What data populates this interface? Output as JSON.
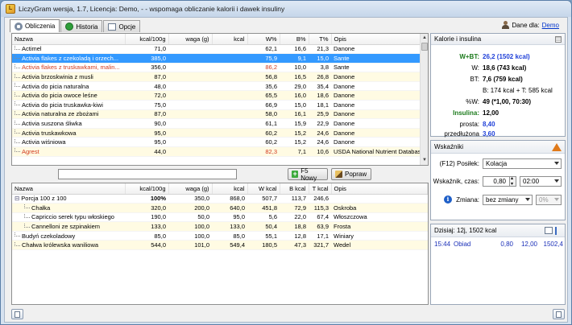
{
  "window": {
    "title": "LiczyGram wersja, 1.7, Licencja: Demo, - - wspomaga obliczanie kalorii i dawek insuliny"
  },
  "tabs": [
    {
      "label": "Obliczenia",
      "active": true,
      "icon": "calculator-icon"
    },
    {
      "label": "Historia",
      "active": false,
      "icon": "history-icon"
    },
    {
      "label": "Opcje",
      "active": false,
      "icon": "options-icon"
    }
  ],
  "user": {
    "label": "Dane dla:",
    "link": "Demo"
  },
  "foods": {
    "columns": [
      "Nazwa",
      "kcal/100g",
      "waga (g)",
      "kcal",
      "W%",
      "B%",
      "T%",
      "Opis"
    ],
    "rows": [
      {
        "name": "Actimel",
        "kcal": "71,0",
        "waga": "",
        "kcal_total": "",
        "w": "62,1",
        "b": "16,6",
        "t": "21,3",
        "opis": "Danone",
        "style": "",
        "w_red": false
      },
      {
        "name": "Activia flakes z czekoladą i orzech...",
        "kcal": "385,0",
        "waga": "",
        "kcal_total": "",
        "w": "75,9",
        "b": "9,1",
        "t": "15,0",
        "opis": "Sante",
        "style": "sel",
        "w_red": false
      },
      {
        "name": "Activia flakes z truskawkami, malin...",
        "kcal": "356,0",
        "waga": "",
        "kcal_total": "",
        "w": "86,2",
        "b": "10,0",
        "t": "3,8",
        "opis": "Sante",
        "style": "red",
        "w_red": true
      },
      {
        "name": "Activia brzoskwinia z musli",
        "kcal": "87,0",
        "waga": "",
        "kcal_total": "",
        "w": "56,8",
        "b": "16,5",
        "t": "26,8",
        "opis": "Danone",
        "style": "",
        "w_red": false
      },
      {
        "name": "Activia do picia naturalna",
        "kcal": "48,0",
        "waga": "",
        "kcal_total": "",
        "w": "35,6",
        "b": "29,0",
        "t": "35,4",
        "opis": "Danone",
        "style": "",
        "w_red": false
      },
      {
        "name": "Activia do picia owoce leśne",
        "kcal": "72,0",
        "waga": "",
        "kcal_total": "",
        "w": "65,5",
        "b": "16,0",
        "t": "18,6",
        "opis": "Danone",
        "style": "",
        "w_red": false
      },
      {
        "name": "Activia do picia truskawka-kiwi",
        "kcal": "75,0",
        "waga": "",
        "kcal_total": "",
        "w": "66,9",
        "b": "15,0",
        "t": "18,1",
        "opis": "Danone",
        "style": "",
        "w_red": false
      },
      {
        "name": "Activia naturalna ze zbożami",
        "kcal": "87,0",
        "waga": "",
        "kcal_total": "",
        "w": "58,0",
        "b": "16,1",
        "t": "25,9",
        "opis": "Danone",
        "style": "",
        "w_red": false
      },
      {
        "name": "Activia suszona śliwka",
        "kcal": "90,0",
        "waga": "",
        "kcal_total": "",
        "w": "61,1",
        "b": "15,9",
        "t": "22,9",
        "opis": "Danone",
        "style": "",
        "w_red": false
      },
      {
        "name": "Activia truskawkowa",
        "kcal": "95,0",
        "waga": "",
        "kcal_total": "",
        "w": "60,2",
        "b": "15,2",
        "t": "24,6",
        "opis": "Danone",
        "style": "",
        "w_red": false
      },
      {
        "name": "Activia wiśniowa",
        "kcal": "95,0",
        "waga": "",
        "kcal_total": "",
        "w": "60,2",
        "b": "15,2",
        "t": "24,6",
        "opis": "Danone",
        "style": "",
        "w_red": false
      },
      {
        "name": "Agrest",
        "kcal": "44,0",
        "waga": "",
        "kcal_total": "",
        "w": "82,3",
        "b": "7,1",
        "t": "10,6",
        "opis": "USDA National Nutrient Database",
        "style": "red",
        "w_red": true
      }
    ]
  },
  "mid": {
    "new_btn": "F5 Nowy",
    "edit_btn": "Popraw"
  },
  "meal": {
    "columns": [
      "Nazwa",
      "kcal/100g",
      "waga (g)",
      "kcal",
      "W kcal",
      "B kcal",
      "T kcal",
      "Opis"
    ],
    "rows": [
      {
        "name": "Porcja 100 z 100",
        "kcal100": "100%",
        "waga": "350,0",
        "kcal": "868,0",
        "w": "507,7",
        "b": "113,7",
        "t": "246,6",
        "opis": "",
        "level": 0,
        "bold_pct": true
      },
      {
        "name": "Chałka",
        "kcal100": "320,0",
        "waga": "200,0",
        "kcal": "640,0",
        "w": "451,8",
        "b": "72,9",
        "t": "115,3",
        "opis": "Oskroba",
        "level": 1,
        "bold_pct": false
      },
      {
        "name": "Capriccio serek typu włoskiego",
        "kcal100": "190,0",
        "waga": "50,0",
        "kcal": "95,0",
        "w": "5,6",
        "b": "22,0",
        "t": "67,4",
        "opis": "Włoszczowa",
        "level": 1,
        "bold_pct": false
      },
      {
        "name": "Cannelloni ze szpinakiem",
        "kcal100": "133,0",
        "waga": "100,0",
        "kcal": "133,0",
        "w": "50,4",
        "b": "18,8",
        "t": "63,9",
        "opis": "Frosta",
        "level": 1,
        "bold_pct": false
      },
      {
        "name": "Budyń czekoladowy",
        "kcal100": "85,0",
        "waga": "100,0",
        "kcal": "85,0",
        "w": "55,1",
        "b": "12,8",
        "t": "17,1",
        "opis": "Winiary",
        "level": 0,
        "bold_pct": false
      },
      {
        "name": "Chałwa królewska waniliowa",
        "kcal100": "544,0",
        "waga": "101,0",
        "kcal": "549,4",
        "w": "180,5",
        "b": "47,3",
        "t": "321,7",
        "opis": "Wedel",
        "level": 0,
        "bold_pct": false
      }
    ]
  },
  "kalorie": {
    "title": "Kalorie i insulina",
    "wbt_label": "W+BT:",
    "wbt_value": "26,2 (1502 kcal)",
    "w_label": "W:",
    "w_value": "18,6 (743 kcal)",
    "bt_label": "BT:",
    "bt_value": "7,6 (759 kcal)",
    "bt_detail": "B: 174 kcal + T: 585 kcal",
    "pw_label": "%W:",
    "pw_value": "49 (*1,00, 70:30)",
    "ins_label": "Insulina:",
    "ins_value": "12,00",
    "prosta_label": "prosta:",
    "prosta_value": "8,40",
    "przed_label": "przedłużona",
    "przed_value": "3,60"
  },
  "wskazniki": {
    "title": "Wskaźniki",
    "posilek_label": "(F12) Posiłek:",
    "posilek_value": "Kolacja",
    "czas_label": "Wskaźnik, czas:",
    "czas_value": "0,80",
    "time_value": "02:00",
    "zmiana_label": "Zmiana:",
    "zmiana_value": "bez zmiany",
    "pct_value": "0%"
  },
  "dzisiaj": {
    "title": "Dzisiaj: 12j, 1502 kcal",
    "entries": [
      {
        "time": "15:44",
        "meal": "Obiad",
        "a": "0,80",
        "b": "12,00",
        "c": "1502,4"
      }
    ]
  },
  "colors": {
    "accent": "#3399ff",
    "red_text": "#d23a1e",
    "blue_value": "#1e3fd8",
    "green_label": "#1b7a1b"
  }
}
